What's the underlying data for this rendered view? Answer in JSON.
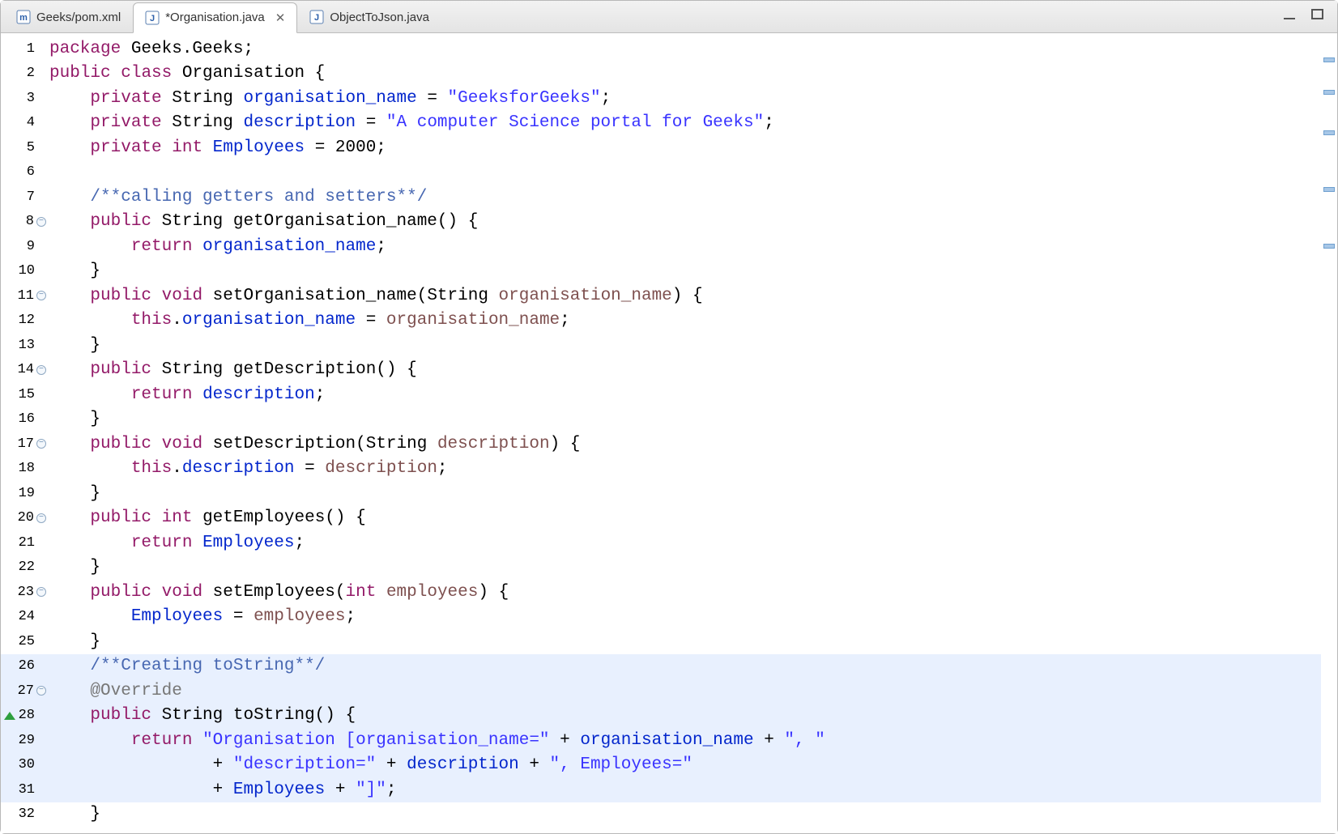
{
  "tabs": [
    {
      "label": "Geeks/pom.xml",
      "icon": "maven-icon"
    },
    {
      "label": "*Organisation.java",
      "icon": "java-icon",
      "active": true,
      "closeable": true
    },
    {
      "label": "ObjectToJson.java",
      "icon": "java-icon"
    }
  ],
  "closeGlyph": "✕",
  "lines": [
    {
      "n": 1,
      "fold": false
    },
    {
      "n": 2,
      "fold": false
    },
    {
      "n": 3,
      "fold": false
    },
    {
      "n": 4,
      "fold": false
    },
    {
      "n": 5,
      "fold": false
    },
    {
      "n": 6,
      "fold": false
    },
    {
      "n": 7,
      "fold": false
    },
    {
      "n": 8,
      "fold": true
    },
    {
      "n": 9,
      "fold": false
    },
    {
      "n": 10,
      "fold": false
    },
    {
      "n": 11,
      "fold": true
    },
    {
      "n": 12,
      "fold": false
    },
    {
      "n": 13,
      "fold": false
    },
    {
      "n": 14,
      "fold": true
    },
    {
      "n": 15,
      "fold": false
    },
    {
      "n": 16,
      "fold": false
    },
    {
      "n": 17,
      "fold": true
    },
    {
      "n": 18,
      "fold": false
    },
    {
      "n": 19,
      "fold": false
    },
    {
      "n": 20,
      "fold": true
    },
    {
      "n": 21,
      "fold": false
    },
    {
      "n": 22,
      "fold": false
    },
    {
      "n": 23,
      "fold": true
    },
    {
      "n": 24,
      "fold": false
    },
    {
      "n": 25,
      "fold": false
    },
    {
      "n": 26,
      "fold": false,
      "hl": true
    },
    {
      "n": 27,
      "fold": true,
      "hl": true
    },
    {
      "n": 28,
      "fold": false,
      "hl": true,
      "override": true
    },
    {
      "n": 29,
      "fold": false,
      "hl": true
    },
    {
      "n": 30,
      "fold": false,
      "hl": true
    },
    {
      "n": 31,
      "fold": false,
      "hl": true
    },
    {
      "n": 32,
      "fold": false
    }
  ],
  "code": {
    "l1": {
      "a": "package",
      "b": " Geeks.Geeks;"
    },
    "l2": {
      "a": "public",
      "b": " ",
      "c": "class",
      "d": " Organisation {"
    },
    "l3": {
      "a": "    ",
      "b": "private",
      "c": " String ",
      "d": "organisation_name",
      "e": " = ",
      "f": "\"GeeksforGeeks\"",
      "g": ";"
    },
    "l4": {
      "a": "    ",
      "b": "private",
      "c": " String ",
      "d": "description",
      "e": " = ",
      "f": "\"A computer Science portal for Geeks\"",
      "g": ";"
    },
    "l5": {
      "a": "    ",
      "b": "private",
      "c": " ",
      "d": "int",
      "e": " ",
      "f": "Employees",
      "g": " = 2000;"
    },
    "l6": {
      "a": "    "
    },
    "l7": {
      "a": "    ",
      "b": "/**calling getters and setters**/"
    },
    "l8": {
      "a": "    ",
      "b": "public",
      "c": " String getOrganisation_name() {"
    },
    "l9": {
      "a": "        ",
      "b": "return",
      "c": " ",
      "d": "organisation_name",
      "e": ";"
    },
    "l10": {
      "a": "    }"
    },
    "l11": {
      "a": "    ",
      "b": "public",
      "c": " ",
      "d": "void",
      "e": " setOrganisation_name(String ",
      "f": "organisation_name",
      "g": ") {"
    },
    "l12": {
      "a": "        ",
      "b": "this",
      "c": ".",
      "d": "organisation_name",
      "e": " = ",
      "f": "organisation_name",
      "g": ";"
    },
    "l13": {
      "a": "    }"
    },
    "l14": {
      "a": "    ",
      "b": "public",
      "c": " String getDescription() {"
    },
    "l15": {
      "a": "        ",
      "b": "return",
      "c": " ",
      "d": "description",
      "e": ";"
    },
    "l16": {
      "a": "    }"
    },
    "l17": {
      "a": "    ",
      "b": "public",
      "c": " ",
      "d": "void",
      "e": " setDescription(String ",
      "f": "description",
      "g": ") {"
    },
    "l18": {
      "a": "        ",
      "b": "this",
      "c": ".",
      "d": "description",
      "e": " = ",
      "f": "description",
      "g": ";"
    },
    "l19": {
      "a": "    }"
    },
    "l20": {
      "a": "    ",
      "b": "public",
      "c": " ",
      "d": "int",
      "e": " getEmployees() {"
    },
    "l21": {
      "a": "        ",
      "b": "return",
      "c": " ",
      "d": "Employees",
      "e": ";"
    },
    "l22": {
      "a": "    }"
    },
    "l23": {
      "a": "    ",
      "b": "public",
      "c": " ",
      "d": "void",
      "e": " setEmployees(",
      "f": "int",
      "g": " ",
      "h": "employees",
      "i": ") {"
    },
    "l24": {
      "a": "        ",
      "b": "Employees",
      "c": " = ",
      "d": "employees",
      "e": ";"
    },
    "l25": {
      "a": "    }"
    },
    "l26": {
      "a": "    ",
      "b": "/**Creating toString**/"
    },
    "l27": {
      "a": "    ",
      "b": "@Override"
    },
    "l28": {
      "a": "    ",
      "b": "public",
      "c": " String toString() {"
    },
    "l29": {
      "a": "        ",
      "b": "return",
      "c": " ",
      "d": "\"Organisation [organisation_name=\"",
      "e": " + ",
      "f": "organisation_name",
      "g": " + ",
      "h": "\", \""
    },
    "l30": {
      "a": "                + ",
      "b": "\"description=\"",
      "c": " + ",
      "d": "description",
      "e": " + ",
      "f": "\", Employees=\""
    },
    "l31": {
      "a": "                + ",
      "b": "Employees",
      "c": " + ",
      "d": "\"]\"",
      "e": ";"
    },
    "l32": {
      "a": "    }"
    }
  },
  "ovMarkers": [
    30,
    70,
    120,
    190,
    260
  ]
}
